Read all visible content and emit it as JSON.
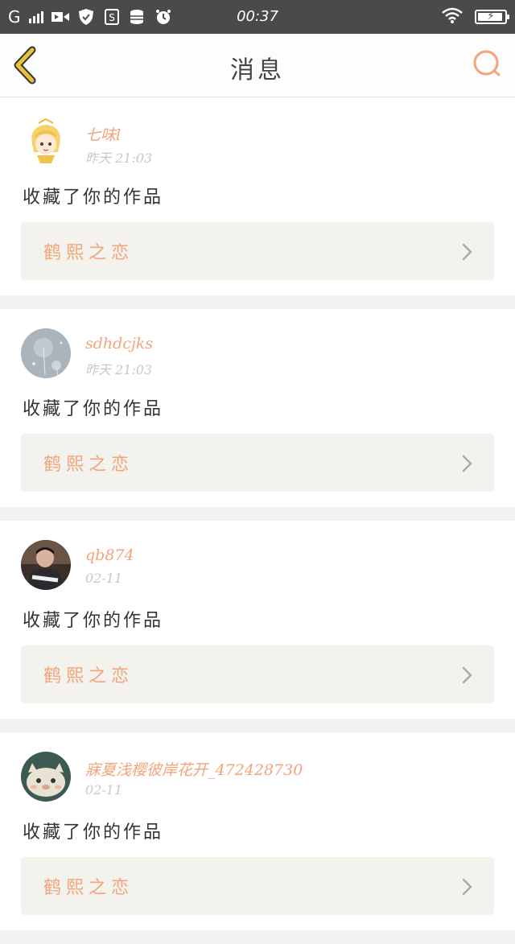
{
  "status_bar": {
    "carrier": "G",
    "time": "00:37",
    "icons": [
      "signal-icon",
      "video-icon",
      "shield-icon",
      "sim-icon",
      "database-icon",
      "alarm-icon",
      "wifi-icon",
      "battery-icon"
    ]
  },
  "nav": {
    "title": "消息",
    "back_icon": "chevron-left-icon",
    "search_icon": "search-icon"
  },
  "colors": {
    "accent": "#f2a47a",
    "back_arrow": "#e8c23a",
    "card_bg": "#f3f2ec",
    "status_bg": "#4a4a4a"
  },
  "messages": [
    {
      "username": "七味l",
      "time": "昨天 21:03",
      "action": "收藏了你的作品",
      "work_title": "鹤熙之恋",
      "avatar": "cartoon-girl-avatar"
    },
    {
      "username": "sdhdcjks",
      "time": "昨天 21:03",
      "action": "收藏了你的作品",
      "work_title": "鹤熙之恋",
      "avatar": "dandelion-avatar"
    },
    {
      "username": "qb874",
      "time": "02-11",
      "action": "收藏了你的作品",
      "work_title": "鹤熙之恋",
      "avatar": "person-photo-avatar"
    },
    {
      "username": "寐夏浅樱彼岸花开_472428730",
      "time": "02-11",
      "action": "收藏了你的作品",
      "work_title": "鹤熙之恋",
      "avatar": "cat-plush-avatar"
    }
  ]
}
